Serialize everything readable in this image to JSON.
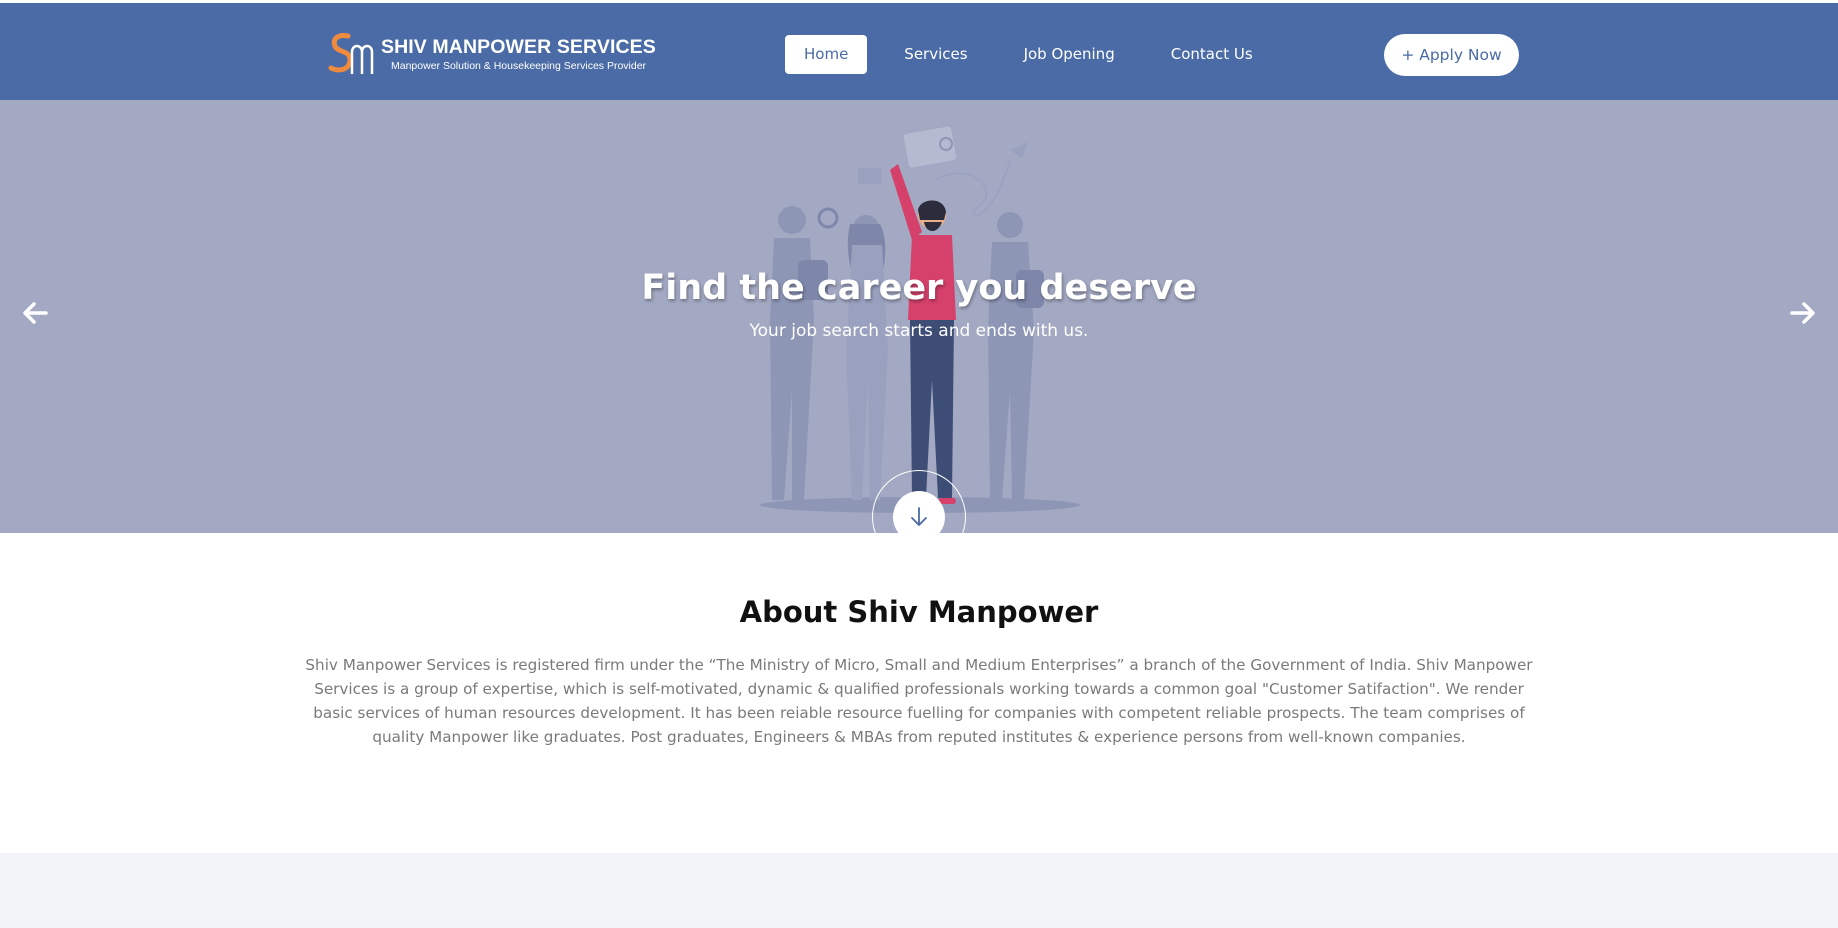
{
  "brand": {
    "title": "SHIV MANPOWER SERVICES",
    "tagline": "Manpower Solution & Housekeeping Services Provider",
    "logo_colors": {
      "primary": "#f08a3c",
      "secondary": "#ffffff"
    }
  },
  "nav": {
    "items": [
      {
        "label": "Home",
        "active": true
      },
      {
        "label": "Services",
        "active": false
      },
      {
        "label": "Job Opening",
        "active": false
      },
      {
        "label": "Contact Us",
        "active": false
      }
    ],
    "apply_label": "+ Apply Now"
  },
  "hero": {
    "title": "Find the career you deserve",
    "subtitle": "Your job search starts and ends with us.",
    "prev_icon": "arrow-left-icon",
    "next_icon": "arrow-right-icon",
    "scroll_icon": "arrow-down-icon"
  },
  "about": {
    "title": "About Shiv Manpower",
    "text": "Shiv Manpower Services is registered firm under the “The Ministry of Micro, Small and Medium Enterprises” a branch of the Government of India. Shiv Manpower Services is a group of expertise, which is self-motivated, dynamic & qualified professionals working towards a common goal \"Customer Satifaction\". We render basic services of human resources development. It has been reiable resource fuelling for companies with competent reliable prospects. The team comprises of quality Manpower like graduates. Post graduates, Engineers & MBAs from reputed institutes & experience persons from well-known companies."
  },
  "colors": {
    "header": "#4a6ba6",
    "hero_overlay": "#a3a9c3",
    "accent": "#4a6ba6"
  }
}
